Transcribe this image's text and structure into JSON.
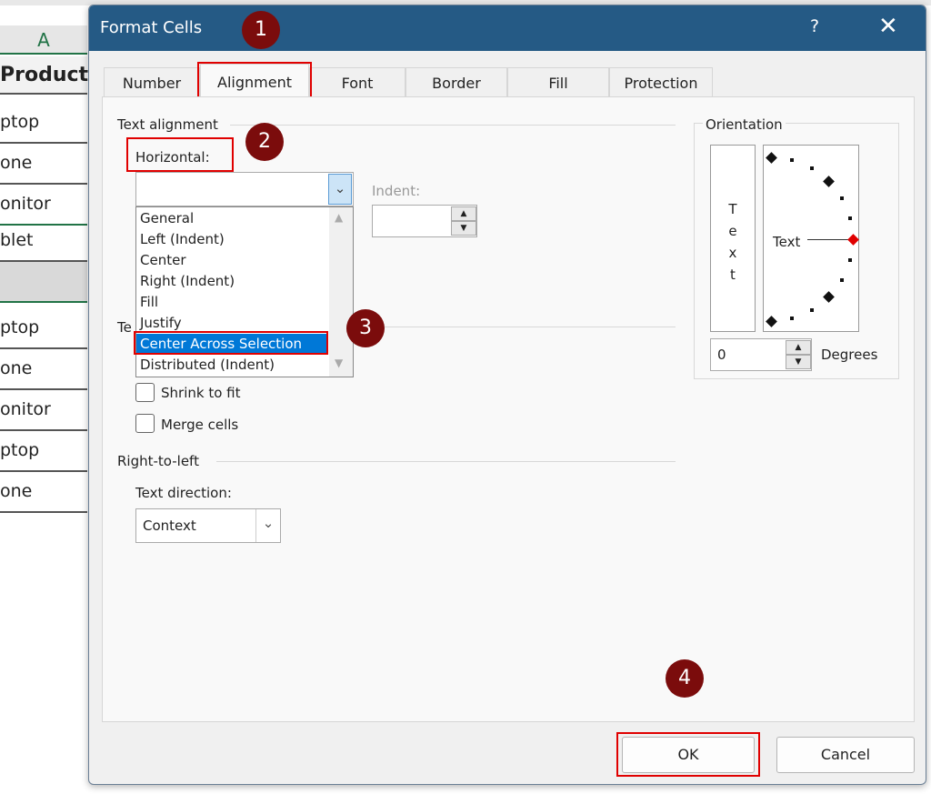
{
  "sheet": {
    "column": "A",
    "header": "Product",
    "cells": [
      "ptop",
      "one",
      "onitor",
      "blet",
      "",
      "ptop",
      "one",
      "onitor",
      "ptop",
      "one"
    ]
  },
  "dialog": {
    "title": "Format Cells",
    "help": "?",
    "close": "✕",
    "tabs": [
      {
        "label": "Number"
      },
      {
        "label": "Alignment",
        "active": true
      },
      {
        "label": "Font"
      },
      {
        "label": "Border"
      },
      {
        "label": "Fill"
      },
      {
        "label": "Protection"
      }
    ],
    "text_alignment": {
      "group": "Text alignment",
      "horizontal_label": "Horizontal:",
      "horizontal_value": "",
      "indent_label": "Indent:",
      "indent_value": "",
      "options": [
        "General",
        "Left (Indent)",
        "Center",
        "Right (Indent)",
        "Fill",
        "Justify",
        "Center Across Selection",
        "Distributed (Indent)"
      ],
      "selected": "Center Across Selection"
    },
    "text_control": {
      "group_partial": "Te",
      "shrink": "Shrink to fit",
      "merge": "Merge cells",
      "shrink_checked": false,
      "merge_checked": false
    },
    "rtl": {
      "group": "Right-to-left",
      "direction_label": "Text direction:",
      "direction_value": "Context"
    },
    "orientation": {
      "group": "Orientation",
      "vertical_text": [
        "T",
        "e",
        "x",
        "t"
      ],
      "dial_text": "Text",
      "degrees_value": "0",
      "degrees_label": "Degrees"
    },
    "ok": "OK",
    "cancel": "Cancel"
  },
  "annotations": [
    "1",
    "2",
    "3",
    "4"
  ],
  "colors": {
    "titlebar": "#255a85",
    "highlight": "#e00000",
    "badge": "#7b0c0c",
    "selection": "#0078d7"
  }
}
